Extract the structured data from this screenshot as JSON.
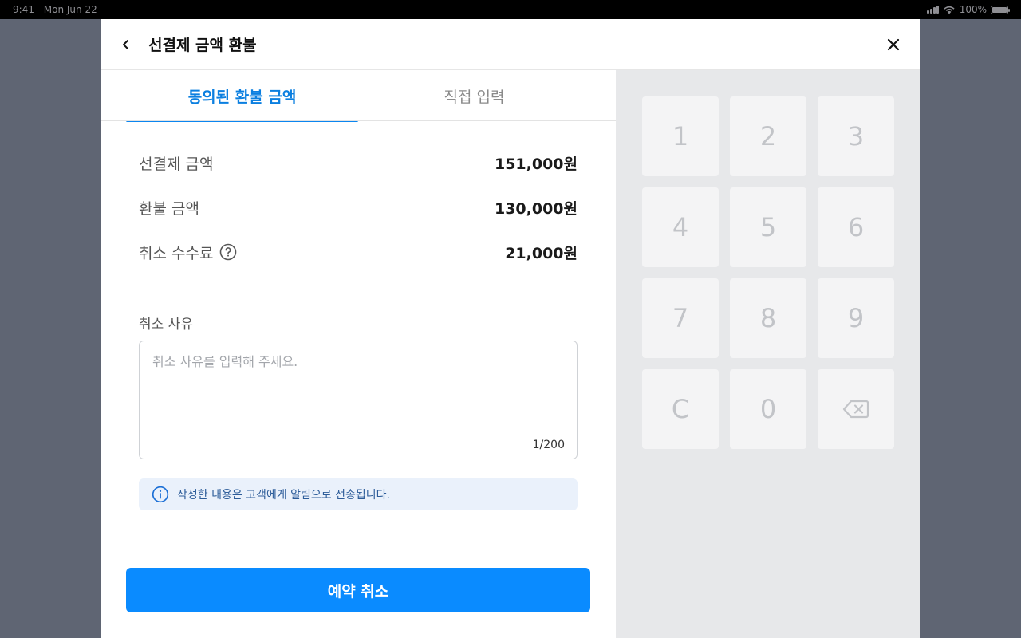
{
  "status_bar": {
    "time": "9:41",
    "date": "Mon Jun 22",
    "battery": "100%"
  },
  "header": {
    "title": "선결제 금액 환불"
  },
  "tabs": [
    {
      "label": "동의된 환불 금액",
      "active": true
    },
    {
      "label": "직접 입력",
      "active": false
    }
  ],
  "summary": {
    "prepaid": {
      "label": "선결제 금액",
      "value": "151,000원"
    },
    "refund": {
      "label": "환불 금액",
      "value": "130,000원"
    },
    "fee": {
      "label": "취소 수수료",
      "value": "21,000원"
    }
  },
  "reason": {
    "label": "취소 사유",
    "placeholder": "취소 사유를 입력해 주세요.",
    "counter": "1/200"
  },
  "info": {
    "text": "작성한 내용은 고객에게 알림으로 전송됩니다."
  },
  "submit": {
    "label": "예약 취소"
  },
  "keypad": {
    "k1": "1",
    "k2": "2",
    "k3": "3",
    "k4": "4",
    "k5": "5",
    "k6": "6",
    "k7": "7",
    "k8": "8",
    "k9": "9",
    "clear": "C",
    "k0": "0",
    "backspace_icon": "backspace-icon"
  },
  "colors": {
    "accent": "#0a8bff",
    "active_tab": "#0b7fe0",
    "info_bg": "#eaf1fb",
    "keypad_bg": "#e7e8ea",
    "backdrop": "#5f6573"
  }
}
